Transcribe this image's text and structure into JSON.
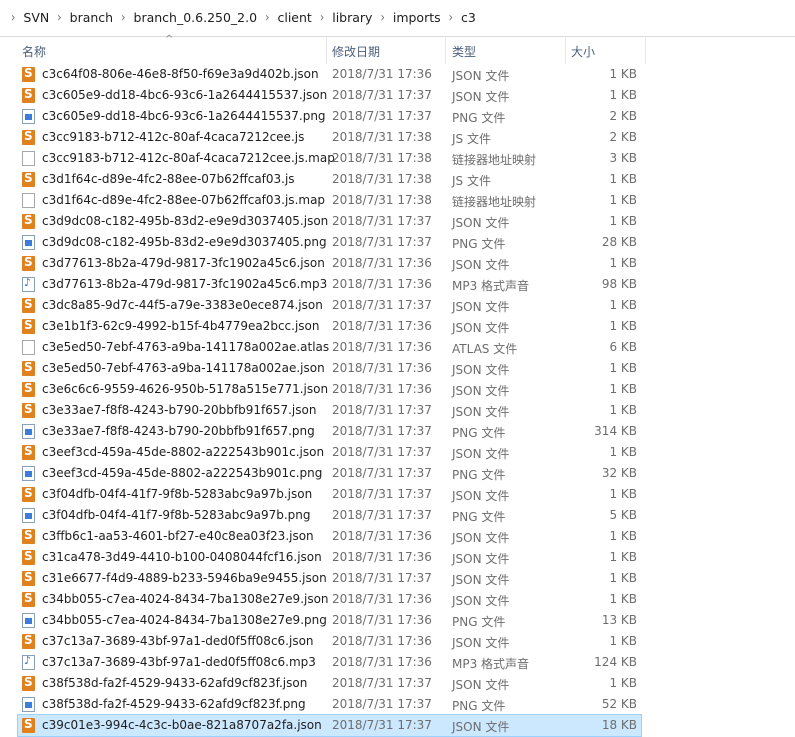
{
  "breadcrumb": [
    "SVN",
    "branch",
    "branch_0.6.250_2.0",
    "client",
    "library",
    "imports",
    "c3"
  ],
  "columns": {
    "name": "名称",
    "date": "修改日期",
    "type": "类型",
    "size": "大小"
  },
  "files": [
    {
      "name": "c3c64f08-806e-46e8-8f50-f69e3a9d402b.json",
      "date": "2018/7/31 17:36",
      "type": "JSON 文件",
      "size": "1 KB",
      "icon": "json-file-icon"
    },
    {
      "name": "c3c605e9-dd18-4bc6-93c6-1a2644415537.json",
      "date": "2018/7/31 17:37",
      "type": "JSON 文件",
      "size": "1 KB",
      "icon": "json-file-icon"
    },
    {
      "name": "c3c605e9-dd18-4bc6-93c6-1a2644415537.png",
      "date": "2018/7/31 17:37",
      "type": "PNG 文件",
      "size": "2 KB",
      "icon": "png-file-icon"
    },
    {
      "name": "c3cc9183-b712-412c-80af-4caca7212cee.js",
      "date": "2018/7/31 17:38",
      "type": "JS 文件",
      "size": "2 KB",
      "icon": "json-file-icon"
    },
    {
      "name": "c3cc9183-b712-412c-80af-4caca7212cee.js.map",
      "date": "2018/7/31 17:38",
      "type": "链接器地址映射",
      "size": "3 KB",
      "icon": "blank-file-icon"
    },
    {
      "name": "c3d1f64c-d89e-4fc2-88ee-07b62ffcaf03.js",
      "date": "2018/7/31 17:38",
      "type": "JS 文件",
      "size": "1 KB",
      "icon": "json-file-icon"
    },
    {
      "name": "c3d1f64c-d89e-4fc2-88ee-07b62ffcaf03.js.map",
      "date": "2018/7/31 17:38",
      "type": "链接器地址映射",
      "size": "1 KB",
      "icon": "blank-file-icon"
    },
    {
      "name": "c3d9dc08-c182-495b-83d2-e9e9d3037405.json",
      "date": "2018/7/31 17:37",
      "type": "JSON 文件",
      "size": "1 KB",
      "icon": "json-file-icon"
    },
    {
      "name": "c3d9dc08-c182-495b-83d2-e9e9d3037405.png",
      "date": "2018/7/31 17:37",
      "type": "PNG 文件",
      "size": "28 KB",
      "icon": "png-file-icon"
    },
    {
      "name": "c3d77613-8b2a-479d-9817-3fc1902a45c6.json",
      "date": "2018/7/31 17:36",
      "type": "JSON 文件",
      "size": "1 KB",
      "icon": "json-file-icon"
    },
    {
      "name": "c3d77613-8b2a-479d-9817-3fc1902a45c6.mp3",
      "date": "2018/7/31 17:36",
      "type": "MP3 格式声音",
      "size": "98 KB",
      "icon": "mp3-file-icon"
    },
    {
      "name": "c3dc8a85-9d7c-44f5-a79e-3383e0ece874.json",
      "date": "2018/7/31 17:37",
      "type": "JSON 文件",
      "size": "1 KB",
      "icon": "json-file-icon"
    },
    {
      "name": "c3e1b1f3-62c9-4992-b15f-4b4779ea2bcc.json",
      "date": "2018/7/31 17:36",
      "type": "JSON 文件",
      "size": "1 KB",
      "icon": "json-file-icon"
    },
    {
      "name": "c3e5ed50-7ebf-4763-a9ba-141178a002ae.atlas",
      "date": "2018/7/31 17:36",
      "type": "ATLAS 文件",
      "size": "6 KB",
      "icon": "blank-file-icon"
    },
    {
      "name": "c3e5ed50-7ebf-4763-a9ba-141178a002ae.json",
      "date": "2018/7/31 17:36",
      "type": "JSON 文件",
      "size": "1 KB",
      "icon": "json-file-icon"
    },
    {
      "name": "c3e6c6c6-9559-4626-950b-5178a515e771.json",
      "date": "2018/7/31 17:36",
      "type": "JSON 文件",
      "size": "1 KB",
      "icon": "json-file-icon"
    },
    {
      "name": "c3e33ae7-f8f8-4243-b790-20bbfb91f657.json",
      "date": "2018/7/31 17:37",
      "type": "JSON 文件",
      "size": "1 KB",
      "icon": "json-file-icon"
    },
    {
      "name": "c3e33ae7-f8f8-4243-b790-20bbfb91f657.png",
      "date": "2018/7/31 17:37",
      "type": "PNG 文件",
      "size": "314 KB",
      "icon": "png-file-icon"
    },
    {
      "name": "c3eef3cd-459a-45de-8802-a222543b901c.json",
      "date": "2018/7/31 17:37",
      "type": "JSON 文件",
      "size": "1 KB",
      "icon": "json-file-icon"
    },
    {
      "name": "c3eef3cd-459a-45de-8802-a222543b901c.png",
      "date": "2018/7/31 17:37",
      "type": "PNG 文件",
      "size": "32 KB",
      "icon": "png-file-icon"
    },
    {
      "name": "c3f04dfb-04f4-41f7-9f8b-5283abc9a97b.json",
      "date": "2018/7/31 17:37",
      "type": "JSON 文件",
      "size": "1 KB",
      "icon": "json-file-icon"
    },
    {
      "name": "c3f04dfb-04f4-41f7-9f8b-5283abc9a97b.png",
      "date": "2018/7/31 17:37",
      "type": "PNG 文件",
      "size": "5 KB",
      "icon": "png-file-icon"
    },
    {
      "name": "c3ffb6c1-aa53-4601-bf27-e40c8ea03f23.json",
      "date": "2018/7/31 17:36",
      "type": "JSON 文件",
      "size": "1 KB",
      "icon": "json-file-icon"
    },
    {
      "name": "c31ca478-3d49-4410-b100-0408044fcf16.json",
      "date": "2018/7/31 17:36",
      "type": "JSON 文件",
      "size": "1 KB",
      "icon": "json-file-icon"
    },
    {
      "name": "c31e6677-f4d9-4889-b233-5946ba9e9455.json",
      "date": "2018/7/31 17:37",
      "type": "JSON 文件",
      "size": "1 KB",
      "icon": "json-file-icon"
    },
    {
      "name": "c34bb055-c7ea-4024-8434-7ba1308e27e9.json",
      "date": "2018/7/31 17:36",
      "type": "JSON 文件",
      "size": "1 KB",
      "icon": "json-file-icon"
    },
    {
      "name": "c34bb055-c7ea-4024-8434-7ba1308e27e9.png",
      "date": "2018/7/31 17:36",
      "type": "PNG 文件",
      "size": "13 KB",
      "icon": "png-file-icon"
    },
    {
      "name": "c37c13a7-3689-43bf-97a1-ded0f5ff08c6.json",
      "date": "2018/7/31 17:36",
      "type": "JSON 文件",
      "size": "1 KB",
      "icon": "json-file-icon"
    },
    {
      "name": "c37c13a7-3689-43bf-97a1-ded0f5ff08c6.mp3",
      "date": "2018/7/31 17:36",
      "type": "MP3 格式声音",
      "size": "124 KB",
      "icon": "mp3-file-icon"
    },
    {
      "name": "c38f538d-fa2f-4529-9433-62afd9cf823f.json",
      "date": "2018/7/31 17:37",
      "type": "JSON 文件",
      "size": "1 KB",
      "icon": "json-file-icon"
    },
    {
      "name": "c38f538d-fa2f-4529-9433-62afd9cf823f.png",
      "date": "2018/7/31 17:37",
      "type": "PNG 文件",
      "size": "52 KB",
      "icon": "png-file-icon"
    },
    {
      "name": "c39c01e3-994c-4c3c-b0ae-821a8707a2fa.json",
      "date": "2018/7/31 17:37",
      "type": "JSON 文件",
      "size": "18 KB",
      "icon": "json-file-icon",
      "selected": true
    }
  ]
}
